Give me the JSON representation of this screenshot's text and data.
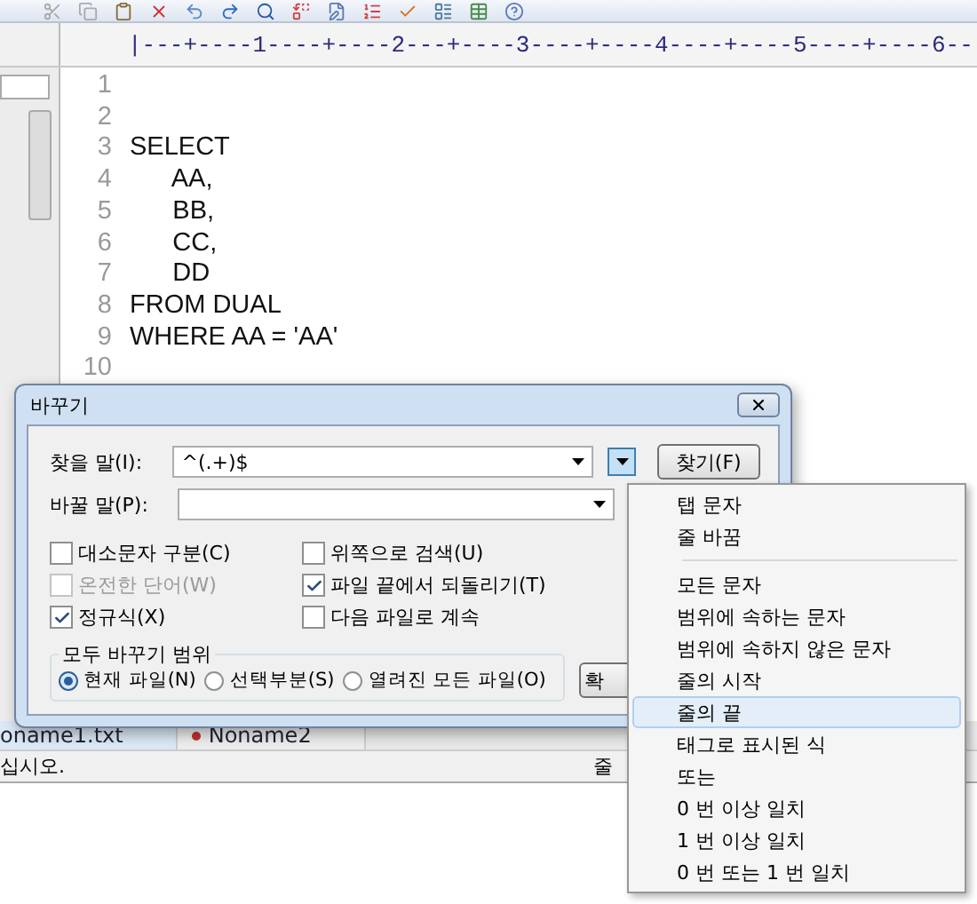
{
  "ruler": {
    "scale": "|---+----1----+----2---+----3----+----4----+----5----+----6--"
  },
  "editor": {
    "lines": [
      {
        "number": "1"
      },
      {
        "number": "2"
      },
      {
        "number": "3",
        "text": "SELECT"
      },
      {
        "number": "4",
        "text": "      AA,"
      },
      {
        "number": "5",
        "text": "      BB,"
      },
      {
        "number": "6",
        "text": "      CC,"
      },
      {
        "number": "7",
        "text": "      DD"
      },
      {
        "number": "8",
        "text": "FROM DUAL"
      },
      {
        "number": "9",
        "text": "WHERE AA = 'AA'"
      },
      {
        "number": "10"
      }
    ]
  },
  "document_tabs": [
    {
      "label": "oname1.txt",
      "selected": true,
      "modified": false
    },
    {
      "label": "Noname2",
      "selected": false,
      "modified": true
    }
  ],
  "status_bar": {
    "message": "십시오.",
    "position": "줄"
  },
  "dialog": {
    "title": "바꾸기",
    "find": {
      "label": "찾을 말(I):",
      "value": "^(.+)$"
    },
    "replace": {
      "label": "바꿀 말(P):"
    },
    "options_button": {
      "pressed": true
    },
    "find_button": "찾기(F)",
    "options": [
      {
        "label": "대소문자 구분(C)",
        "checked": false,
        "disabled": false
      },
      {
        "label": "위쪽으로 검색(U)",
        "checked": false,
        "disabled": false
      },
      {
        "label": "온전한 단어(W)",
        "checked": false,
        "disabled": true
      },
      {
        "label": "파일 끝에서 되돌리기(T)",
        "checked": true,
        "disabled": false
      },
      {
        "label": "정규식(X)",
        "checked": true,
        "disabled": false
      },
      {
        "label": "다음 파일로 계속",
        "checked": false,
        "disabled": false
      }
    ],
    "scope": {
      "title": "모두 바꾸기 범위",
      "choices": [
        {
          "label": "현재 파일(N)",
          "selected": true
        },
        {
          "label": "선택부분(S)",
          "selected": false
        },
        {
          "label": "열려진 모든 파일(O)",
          "selected": false
        }
      ]
    },
    "expand_button": "확"
  },
  "menu": {
    "groups": [
      [
        {
          "label": "탭 문자",
          "selected": false
        },
        {
          "label": "줄 바꿈",
          "selected": false
        }
      ],
      [
        {
          "label": "모든 문자",
          "selected": false
        },
        {
          "label": "범위에 속하는 문자",
          "selected": false
        },
        {
          "label": "범위에 속하지 않은 문자",
          "selected": false
        },
        {
          "label": "줄의 시작",
          "selected": false
        },
        {
          "label": "줄의 끝",
          "selected": true
        },
        {
          "label": "태그로 표시된 식",
          "selected": false
        },
        {
          "label": "또는",
          "selected": false
        },
        {
          "label": "0 번 이상 일치",
          "selected": false
        },
        {
          "label": "1 번 이상 일치",
          "selected": false
        },
        {
          "label": "0 번 또는 1 번 일치",
          "selected": false
        }
      ]
    ]
  }
}
